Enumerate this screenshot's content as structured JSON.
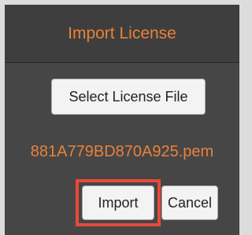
{
  "dialog": {
    "title": "Import License",
    "select_button_label": "Select License File",
    "selected_file": "881A779BD870A925.pem",
    "import_button_label": "Import",
    "cancel_button_label": "Cancel"
  },
  "colors": {
    "accent": "#e8823a",
    "highlight": "#e8493a",
    "background": "#3e3e3e"
  }
}
